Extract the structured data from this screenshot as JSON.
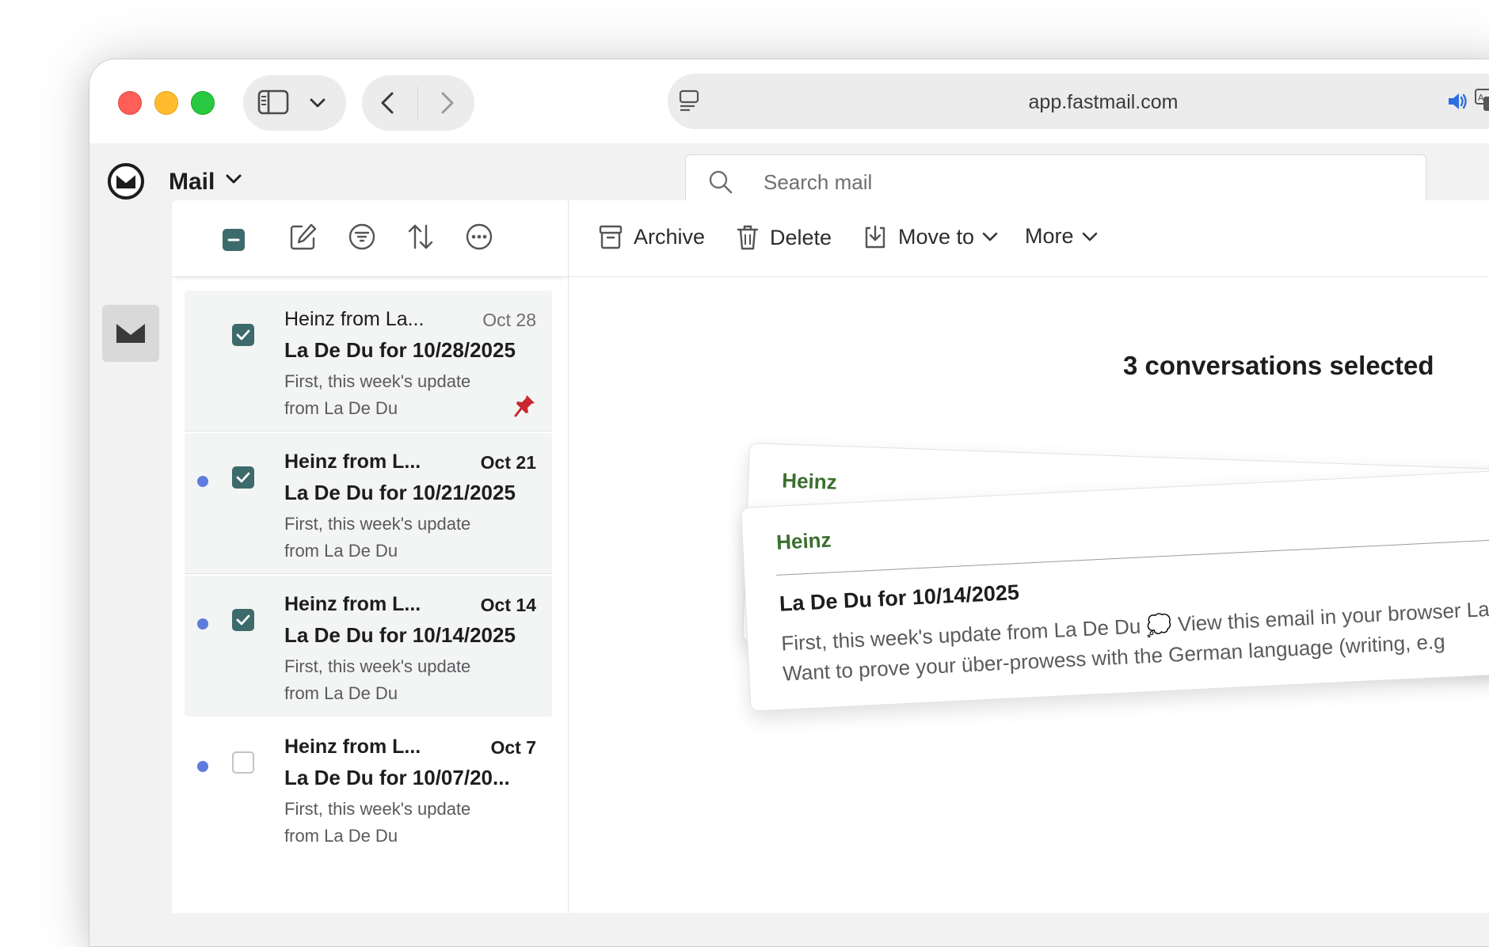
{
  "browser": {
    "url": "app.fastmail.com"
  },
  "app": {
    "title": "Mail",
    "search_placeholder": "Search mail"
  },
  "toolbar": {
    "archive": "Archive",
    "delete": "Delete",
    "move_to": "Move to",
    "more": "More"
  },
  "messages": [
    {
      "from": "Heinz from La...",
      "date": "Oct 28",
      "subject": "La De Du for 10/28/2025",
      "preview": "First, this week's update from La De Du",
      "unread": false,
      "checked": true,
      "pinned": true
    },
    {
      "from": "Heinz from L...",
      "date": "Oct 21",
      "subject": "La De Du for 10/21/2025",
      "preview": "First, this week's update from La De Du",
      "unread": true,
      "checked": true,
      "pinned": false
    },
    {
      "from": "Heinz from L...",
      "date": "Oct 14",
      "subject": "La De Du for 10/14/2025",
      "preview": "First, this week's update from La De Du",
      "unread": true,
      "checked": true,
      "pinned": false
    },
    {
      "from": "Heinz from L...",
      "date": "Oct 7",
      "subject": "La De Du for 10/07/20...",
      "preview": "First, this week's update from La De Du",
      "unread": true,
      "checked": false,
      "pinned": false
    }
  ],
  "selection": {
    "title": "3 conversations selected",
    "back_card": {
      "sender": "Heinz"
    },
    "front_card": {
      "sender": "Heinz",
      "subject": "La De Du for 10/14/2025",
      "preview": "First, this week's update from La De Du 💭 View this email in your browser La De D Keyboard Want to prove your über-prowess with the German language (writing, e.g"
    }
  },
  "colors": {
    "accent_checkbox": "#3d6a6a",
    "unread_dot": "#5f7bdd",
    "sender_green": "#3c6e2e",
    "pin_red": "#c8282f"
  }
}
